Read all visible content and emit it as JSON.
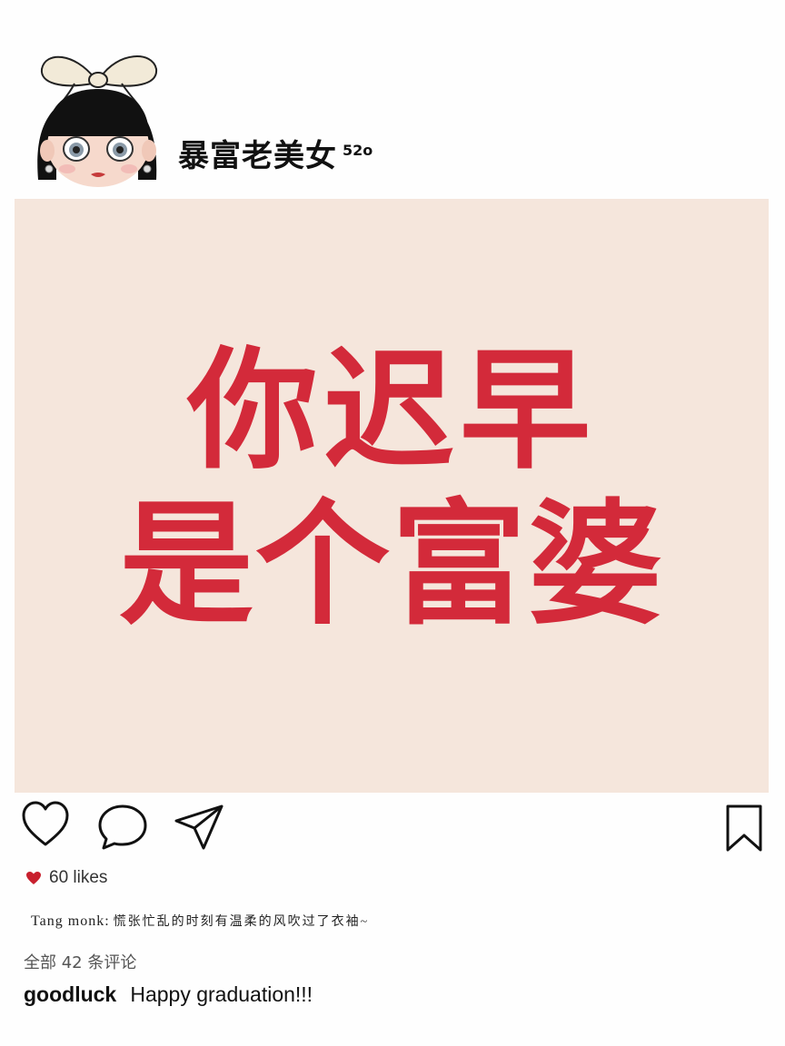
{
  "profile": {
    "username": "暴富老美女",
    "username_suffix": "52o",
    "avatar_icon": "cartoon-girl-avatar"
  },
  "post": {
    "background": "#f5e6dc",
    "text_color": "#d32a3a",
    "line1": "你迟早",
    "line2": "是个富婆"
  },
  "actions": {
    "like_icon": "heart-outline-icon",
    "comment_icon": "comment-bubble-icon",
    "share_icon": "paper-plane-icon",
    "save_icon": "bookmark-icon"
  },
  "likes": {
    "icon": "heart-filled-icon",
    "icon_color": "#c8202e",
    "text": "60 likes"
  },
  "caption": {
    "user": "Tang monk:",
    "text": "慌张忙乱的时刻有温柔的风吹过了衣袖~"
  },
  "comments": {
    "summary": "全部 42 条评论",
    "items": [
      {
        "user": "goodluck",
        "text": "Happy graduation!!!"
      }
    ]
  }
}
